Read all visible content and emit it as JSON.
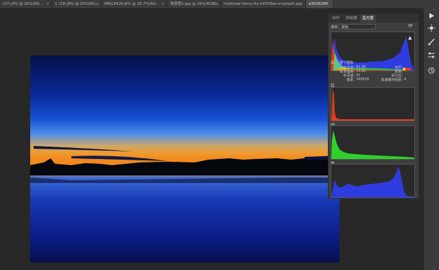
{
  "tabs": [
    {
      "label": "(17).JPG @ 25%(RG...",
      "active": false
    },
    {
      "label": "1 (19).JPG @ 25%(RG...",
      "active": false
    },
    {
      "label": "IMGL9420.JPG @ 16.7%(RG...",
      "active": false
    },
    {
      "label": "场景图1.jpg @ 25%(RGB/...",
      "active": false
    },
    {
      "label": "matthew-henry-6x-hVXX8ss-unsplash.jpg",
      "active": false
    },
    {
      "label": "e30362f8f",
      "active": true
    }
  ],
  "panel": {
    "tabs": [
      "动作",
      "导航器",
      "直方图"
    ],
    "channel_label": "通道:",
    "channel_value": "颜色",
    "source_label": "源:",
    "source_value": "整个图像",
    "stats": {
      "mean_label": "平均值:",
      "mean_value": "82.80",
      "stddev_label": "标准偏差:",
      "stddev_value": "73.60",
      "median_label": "中间值:",
      "median_value": "51",
      "pixels_label": "像素:",
      "pixels_value": "345600",
      "level_label": "色阶:",
      "count_label": "数量:",
      "percentile_label": "百分位:",
      "cache_label": "高速缓存级别:",
      "cache_value": "4"
    },
    "channels": [
      "红",
      "绿",
      "蓝"
    ]
  },
  "colors": {
    "red": "#e23a1e",
    "green": "#2fd12a",
    "blue": "#2f3ce0"
  },
  "icons": {
    "refresh": "refresh-icon",
    "warning": "warning-icon",
    "play": "play-icon",
    "sun": "sun-icon",
    "brush": "brush-icon",
    "sliders": "sliders-icon",
    "history": "history-icon"
  }
}
